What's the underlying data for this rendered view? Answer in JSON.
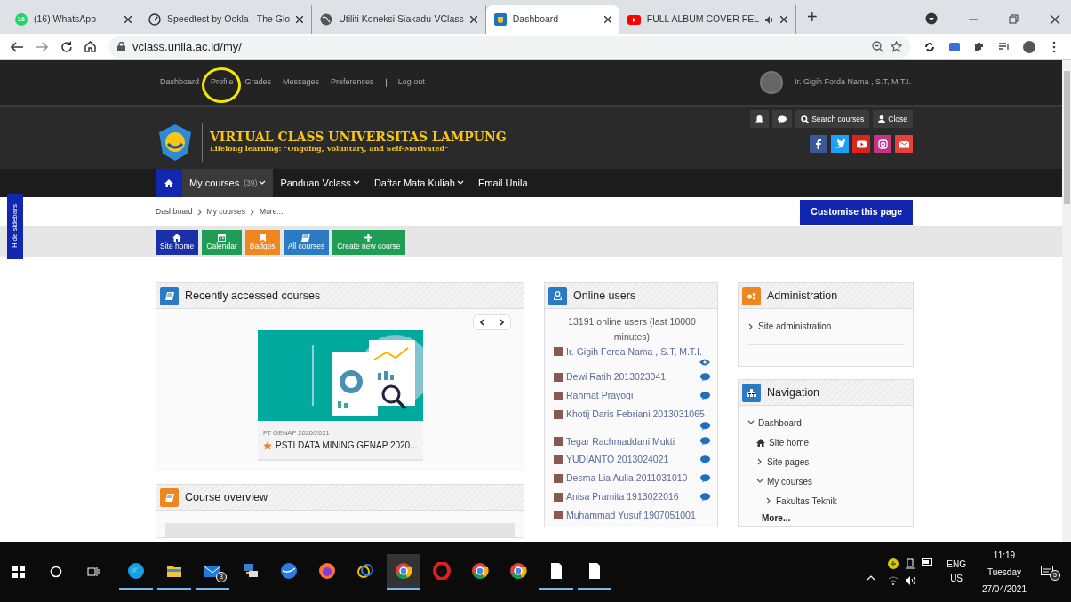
{
  "browser": {
    "tabs": [
      {
        "title": "(16) WhatsApp",
        "kind": "whatsapp",
        "badge": "16",
        "selected": false,
        "audio": false
      },
      {
        "title": "Speedtest by Ookla - The Glo",
        "kind": "gauge",
        "selected": false,
        "audio": false
      },
      {
        "title": "Utiliti Koneksi Siakadu-VClass",
        "kind": "globe",
        "selected": false,
        "audio": false
      },
      {
        "title": "Dashboard",
        "kind": "site",
        "selected": true,
        "audio": false
      },
      {
        "title": "FULL ALBUM COVER FEL",
        "kind": "video",
        "selected": false,
        "audio": true
      }
    ],
    "new_tab": "+",
    "url": "vclass.unila.ac.id/my/"
  },
  "topbar": {
    "links": [
      "Dashboard",
      "Profile",
      "Grades",
      "Messages",
      "Preferences",
      "Log out"
    ],
    "user": "Ir. Gigih Forda Nama , S.T, M.T.I."
  },
  "header": {
    "title": "VIRTUAL CLASS UNIVERSITAS LAMPUNG",
    "tagline": "Lifelong learning: \"Ongoing, Voluntary, and Self-Motivated\"",
    "search": "Search courses",
    "close": "Close",
    "social": [
      {
        "kind": "facebook",
        "color": "#3b5998"
      },
      {
        "kind": "twitter",
        "color": "#1da1f2"
      },
      {
        "kind": "youtube",
        "color": "#d9251d"
      },
      {
        "kind": "instagram",
        "color": "#c13584"
      },
      {
        "kind": "mail",
        "color": "#e8403a"
      }
    ]
  },
  "nav": {
    "items": [
      {
        "label": "My courses",
        "count": "(39)",
        "dropdown": true,
        "selected": true
      },
      {
        "label": "Panduan Vclass",
        "dropdown": true,
        "selected": false
      },
      {
        "label": "Daftar Mata Kuliah",
        "dropdown": true,
        "selected": false
      },
      {
        "label": "Email Unila",
        "dropdown": false,
        "selected": false
      }
    ]
  },
  "hide_sidebars": "Hide sidebars",
  "breadcrumb": [
    "Dashboard",
    "My courses",
    "More..."
  ],
  "customise": "Customise this page",
  "quick_buttons": [
    {
      "label": "Site home",
      "kind": "home",
      "color": "#1a2fa8"
    },
    {
      "label": "Calendar",
      "kind": "calendar",
      "color": "#1f9d55"
    },
    {
      "label": "Badges",
      "kind": "bookmark",
      "color": "#f0861e"
    },
    {
      "label": "All courses",
      "kind": "book",
      "color": "#2b7bc4"
    },
    {
      "label": "Create new course",
      "kind": "plus",
      "color": "#1f9d55"
    }
  ],
  "recent": {
    "title": "Recently accessed courses",
    "course": {
      "category": "FT GENAP 2020/2021",
      "name": "PSTI DATA MINING GENAP 2020...",
      "starred": true
    }
  },
  "course_overview": {
    "title": "Course overview"
  },
  "online_users": {
    "title": "Online users",
    "summary": "13191 online users (last 10000 minutes)",
    "users": [
      {
        "name": "Ir. Gigih Forda Nama , S.T, M.T.I.",
        "kind": "eye"
      },
      {
        "name": "Dewi Ratih 2013023041",
        "kind": "message"
      },
      {
        "name": "Rahmat Prayogi",
        "kind": "message"
      },
      {
        "name": "Khotij Daris Febriani 2013031065",
        "kind": "message"
      },
      {
        "name": "Tegar Rachmaddani Mukti",
        "kind": "message"
      },
      {
        "name": "YUDIANTO 2013024021",
        "kind": "message"
      },
      {
        "name": "Desma Lia Aulia 2011031010",
        "kind": "message"
      },
      {
        "name": "Anisa Pramita 1913022016",
        "kind": "message"
      },
      {
        "name": "Muhammad Yusuf 1907051001",
        "kind": "plain"
      }
    ]
  },
  "administration": {
    "title": "Administration",
    "items": [
      "Site administration"
    ]
  },
  "navigation": {
    "title": "Navigation",
    "tree": [
      {
        "label": "Dashboard",
        "kind": "branch",
        "expanded": true,
        "children": [
          {
            "label": "Site home",
            "kind": "home"
          },
          {
            "label": "Site pages",
            "kind": "branch",
            "expanded": false
          },
          {
            "label": "My courses",
            "kind": "branch",
            "expanded": true,
            "children": [
              {
                "label": "Fakultas Teknik",
                "kind": "branch",
                "expanded": false
              }
            ]
          }
        ]
      }
    ],
    "more": "More..."
  },
  "taskbar": {
    "apps": [
      {
        "kind": "edge",
        "running": true,
        "active": false
      },
      {
        "kind": "explorer",
        "running": true,
        "active": false
      },
      {
        "kind": "mail",
        "running": true,
        "active": false,
        "badge": "3"
      },
      {
        "kind": "network",
        "running": false,
        "active": false
      },
      {
        "kind": "bluecircle",
        "running": false,
        "active": false
      },
      {
        "kind": "firefox",
        "running": false,
        "active": false
      },
      {
        "kind": "rings",
        "running": false,
        "active": false
      },
      {
        "kind": "chrome",
        "running": true,
        "active": true
      },
      {
        "kind": "opera",
        "running": false,
        "active": false
      },
      {
        "kind": "chrome",
        "running": false,
        "active": false
      },
      {
        "kind": "chrome",
        "running": false,
        "active": false
      },
      {
        "kind": "file",
        "running": true,
        "active": false
      },
      {
        "kind": "file",
        "running": true,
        "active": false
      }
    ],
    "tray": {
      "language": "ENG",
      "region": "US",
      "time": "11:19",
      "day": "Tuesday",
      "date": "27/04/2021",
      "notifications": "5"
    }
  }
}
